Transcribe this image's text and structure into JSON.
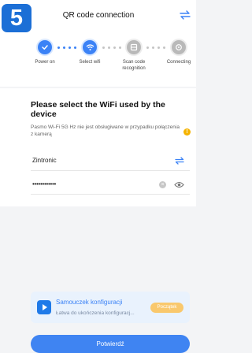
{
  "step_badge": "5",
  "header": {
    "title": "QR code connection",
    "switch_icon": "swap-icon"
  },
  "steps": [
    {
      "label": "Power on",
      "state": "done",
      "icon": "check-icon"
    },
    {
      "label": "Select wifi",
      "state": "active",
      "icon": "wifi-icon"
    },
    {
      "label": "Scan code recognition",
      "state": "pending",
      "icon": "scan-icon"
    },
    {
      "label": "Connecting",
      "state": "pending",
      "icon": "connecting-icon"
    }
  ],
  "main": {
    "heading": "Please select the WiFi used by the device",
    "note": "Pasmo Wi-Fi 5G Hz nie jest obsługiwane w przypadku połączenia z kamerą",
    "wifi_name": "Zintronic",
    "password_mask": "••••••••••••"
  },
  "tutorial": {
    "title": "Samouczek konfiguracji",
    "subtitle": "Łatwa do ukończenia konfiguracj...",
    "start_label": "Początek"
  },
  "confirm_label": "Potwierdź",
  "colors": {
    "accent": "#3f84f2",
    "badge": "#1c6fd6",
    "warning": "#f5b300",
    "start_button": "#f9c86d"
  }
}
